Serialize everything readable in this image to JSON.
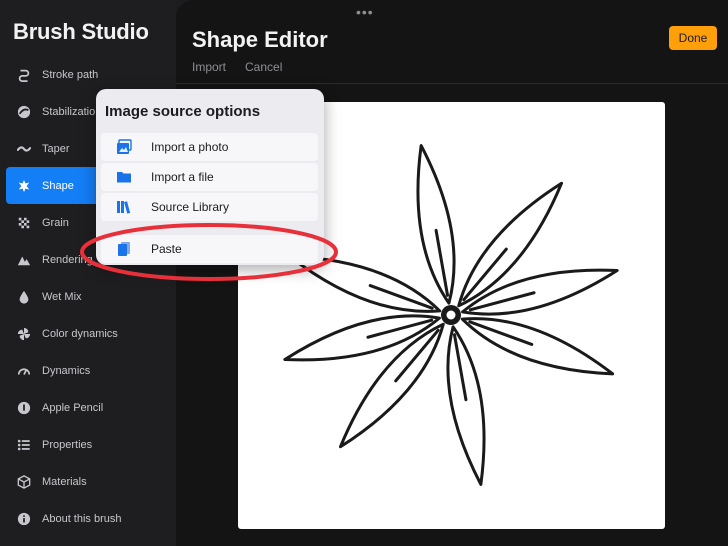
{
  "app": {
    "title": "Brush Studio"
  },
  "sidebar": {
    "items": [
      {
        "label": "Stroke path",
        "icon": "stroke-path-icon"
      },
      {
        "label": "Stabilization",
        "icon": "stabilization-icon"
      },
      {
        "label": "Taper",
        "icon": "taper-icon"
      },
      {
        "label": "Shape",
        "icon": "shape-icon",
        "active": true
      },
      {
        "label": "Grain",
        "icon": "grain-icon"
      },
      {
        "label": "Rendering",
        "icon": "rendering-icon"
      },
      {
        "label": "Wet Mix",
        "icon": "wet-mix-icon"
      },
      {
        "label": "Color dynamics",
        "icon": "color-dynamics-icon"
      },
      {
        "label": "Dynamics",
        "icon": "dynamics-icon"
      },
      {
        "label": "Apple Pencil",
        "icon": "apple-pencil-icon"
      },
      {
        "label": "Properties",
        "icon": "properties-icon"
      },
      {
        "label": "Materials",
        "icon": "materials-icon"
      },
      {
        "label": "About this brush",
        "icon": "info-icon"
      }
    ]
  },
  "editor": {
    "grabber": "•••",
    "title": "Shape Editor",
    "tabs": {
      "import": "Import",
      "cancel": "Cancel"
    },
    "done_label": "Done"
  },
  "popover": {
    "title": "Image source options",
    "items": [
      {
        "label": "Import a photo",
        "icon": "photo-icon"
      },
      {
        "label": "Import a file",
        "icon": "folder-icon"
      },
      {
        "label": "Source Library",
        "icon": "library-icon"
      },
      {
        "label": "Paste",
        "icon": "paste-icon"
      }
    ]
  },
  "colors": {
    "accent": "#147ef6",
    "done": "#ff9f0a",
    "highlight": "#e8303a"
  }
}
